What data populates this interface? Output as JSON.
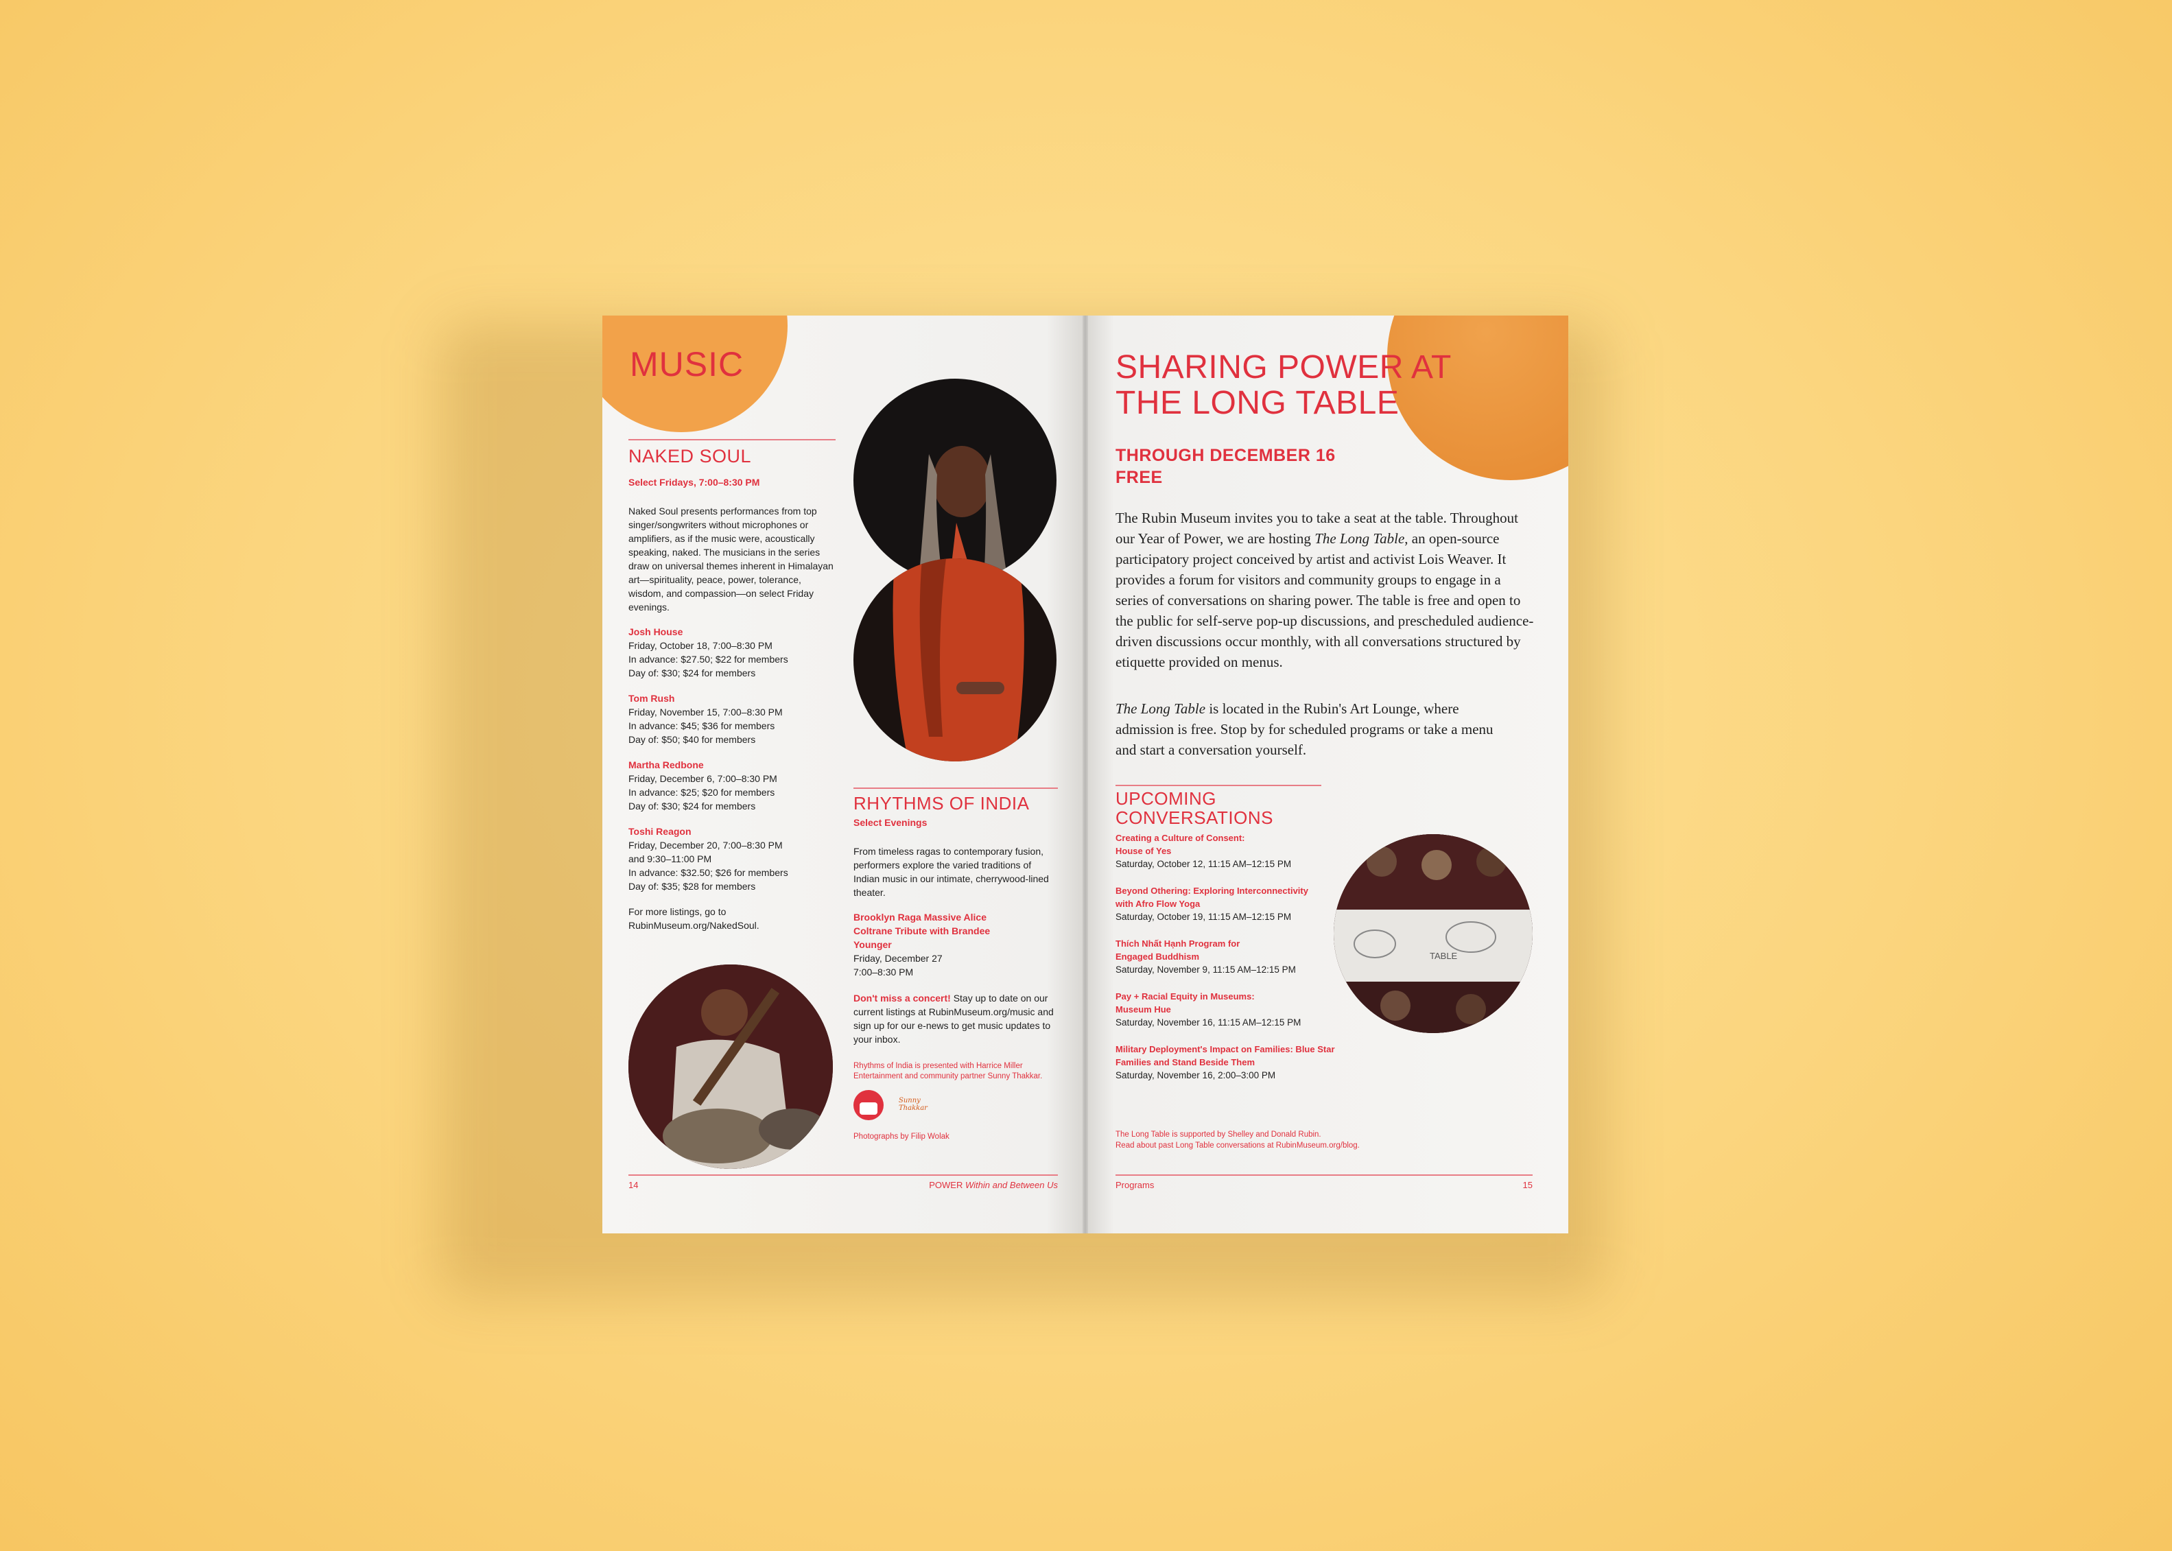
{
  "left": {
    "section_title": "MUSIC",
    "naked_soul": {
      "heading": "NAKED SOUL",
      "subheading": "Select Fridays, 7:00–8:30 PM",
      "description": "Naked Soul presents performances from top singer/songwriters without microphones or amplifiers, as if the music were, acoustically speaking, naked. The musicians in the series draw on universal themes inherent in Himalayan art—spirituality, peace, power, tolerance, wisdom, and compassion—on select Friday evenings.",
      "events": [
        {
          "name": "Josh House",
          "lines": [
            "Friday, October 18, 7:00–8:30 PM",
            "In advance: $27.50; $22 for members",
            "Day of: $30; $24 for members"
          ]
        },
        {
          "name": "Tom Rush",
          "lines": [
            "Friday, November 15, 7:00–8:30 PM",
            "In advance: $45; $36 for members",
            "Day of: $50; $40 for members"
          ]
        },
        {
          "name": "Martha Redbone",
          "lines": [
            "Friday, December 6, 7:00–8:30 PM",
            "In advance: $25; $20 for members",
            "Day of: $30; $24 for members"
          ]
        },
        {
          "name": "Toshi Reagon",
          "lines": [
            "Friday, December 20, 7:00–8:30 PM",
            "and 9:30–11:00 PM",
            "In advance: $32.50; $26 for members",
            "Day of: $35; $28 for members"
          ]
        }
      ],
      "more_listings": "For more listings, go to RubinMuseum.org/NakedSoul."
    },
    "rhythms": {
      "heading": "RHYTHMS OF INDIA",
      "subheading": "Select Evenings",
      "description": "From timeless ragas to contemporary fusion, performers explore the varied traditions of Indian music in our intimate, cherrywood-lined theater.",
      "event_name": "Brooklyn Raga Massive Alice Coltrane Tribute with Brandee Younger",
      "event_lines": [
        "Friday, December 27",
        "7:00–8:30 PM"
      ],
      "cta_bold": "Don't miss a concert!",
      "cta_text": " Stay up to date on our current listings at RubinMuseum.org/music and sign up for our e-news to get music updates to your inbox.",
      "credit": "Rhythms of India is presented with Harrice Miller Entertainment and community partner Sunny Thakkar.",
      "logo_text": "Sunny Thakkar",
      "photo_credit": "Photographs by Filip Wolak"
    },
    "footer": {
      "page_number": "14",
      "title_main": "POWER ",
      "title_italic": "Within and Between Us"
    }
  },
  "right": {
    "title": "SHARING POWER AT THE LONG TABLE",
    "date_line": "THROUGH DECEMBER 16",
    "price_line": "FREE",
    "para1_a": "The Rubin Museum invites you to take a seat at the table. Throughout our Year of Power, we are hosting ",
    "para1_italic": "The Long Table",
    "para1_b": ", an open-source participatory project conceived by artist and activist Lois Weaver. It provides a forum for visitors and community groups to engage in a series of conversations on sharing power. The table is free and open to the public for self-serve pop-up discussions, and prescheduled audience-driven discussions occur monthly, with all conversations structured by etiquette provided on menus.",
    "para2_italic": "The Long Table",
    "para2_b": " is located in the Rubin's Art Lounge, where admission is free. Stop by for scheduled programs or take a menu and start a conversation yourself.",
    "upcoming_heading": "UPCOMING CONVERSATIONS",
    "conversations": [
      {
        "title": "Creating a Culture of Consent: House of Yes",
        "date": "Saturday, October 12, 11:15 AM–12:15 PM"
      },
      {
        "title": "Beyond Othering: Exploring Interconnectivity with Afro Flow Yoga",
        "date": "Saturday, October 19, 11:15 AM–12:15 PM"
      },
      {
        "title": "Thích Nhất Hạnh Program for Engaged Buddhism",
        "date": "Saturday, November 9, 11:15 AM–12:15 PM"
      },
      {
        "title": "Pay + Racial Equity in Museums: Museum Hue",
        "date": "Saturday, November 16, 11:15 AM–12:15 PM"
      },
      {
        "title": "Military Deployment's Impact on Families: Blue Star Families and Stand Beside Them",
        "date": "Saturday, November 16, 2:00–3:00 PM"
      }
    ],
    "support_line1": "The Long Table is supported by Shelley and Donald Rubin.",
    "support_line2": "Read about past Long Table conversations at RubinMuseum.org/blog.",
    "table_label": "TABLE",
    "footer": {
      "section": "Programs",
      "page_number": "15"
    }
  },
  "colors": {
    "accent_red": "#e0313e",
    "orange_circle": "#f2a24a",
    "orange_dark": "#e8892f",
    "background": "#fbd57e"
  }
}
